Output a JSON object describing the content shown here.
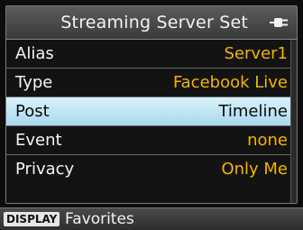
{
  "header": {
    "title": "Streaming Server Set",
    "icon": "plug-icon"
  },
  "rows": [
    {
      "label": "Alias",
      "value": "Server1"
    },
    {
      "label": "Type",
      "value": "Facebook Live"
    },
    {
      "label": "Post",
      "value": "Timeline"
    },
    {
      "label": "Event",
      "value": "none"
    },
    {
      "label": "Privacy",
      "value": "Only Me"
    }
  ],
  "selected_row": "Post",
  "footer": {
    "button_label": "DISPLAY",
    "action_label": "Favorites"
  },
  "colors": {
    "value": "#f4b400",
    "selected_bg": "#bfe6f5"
  }
}
